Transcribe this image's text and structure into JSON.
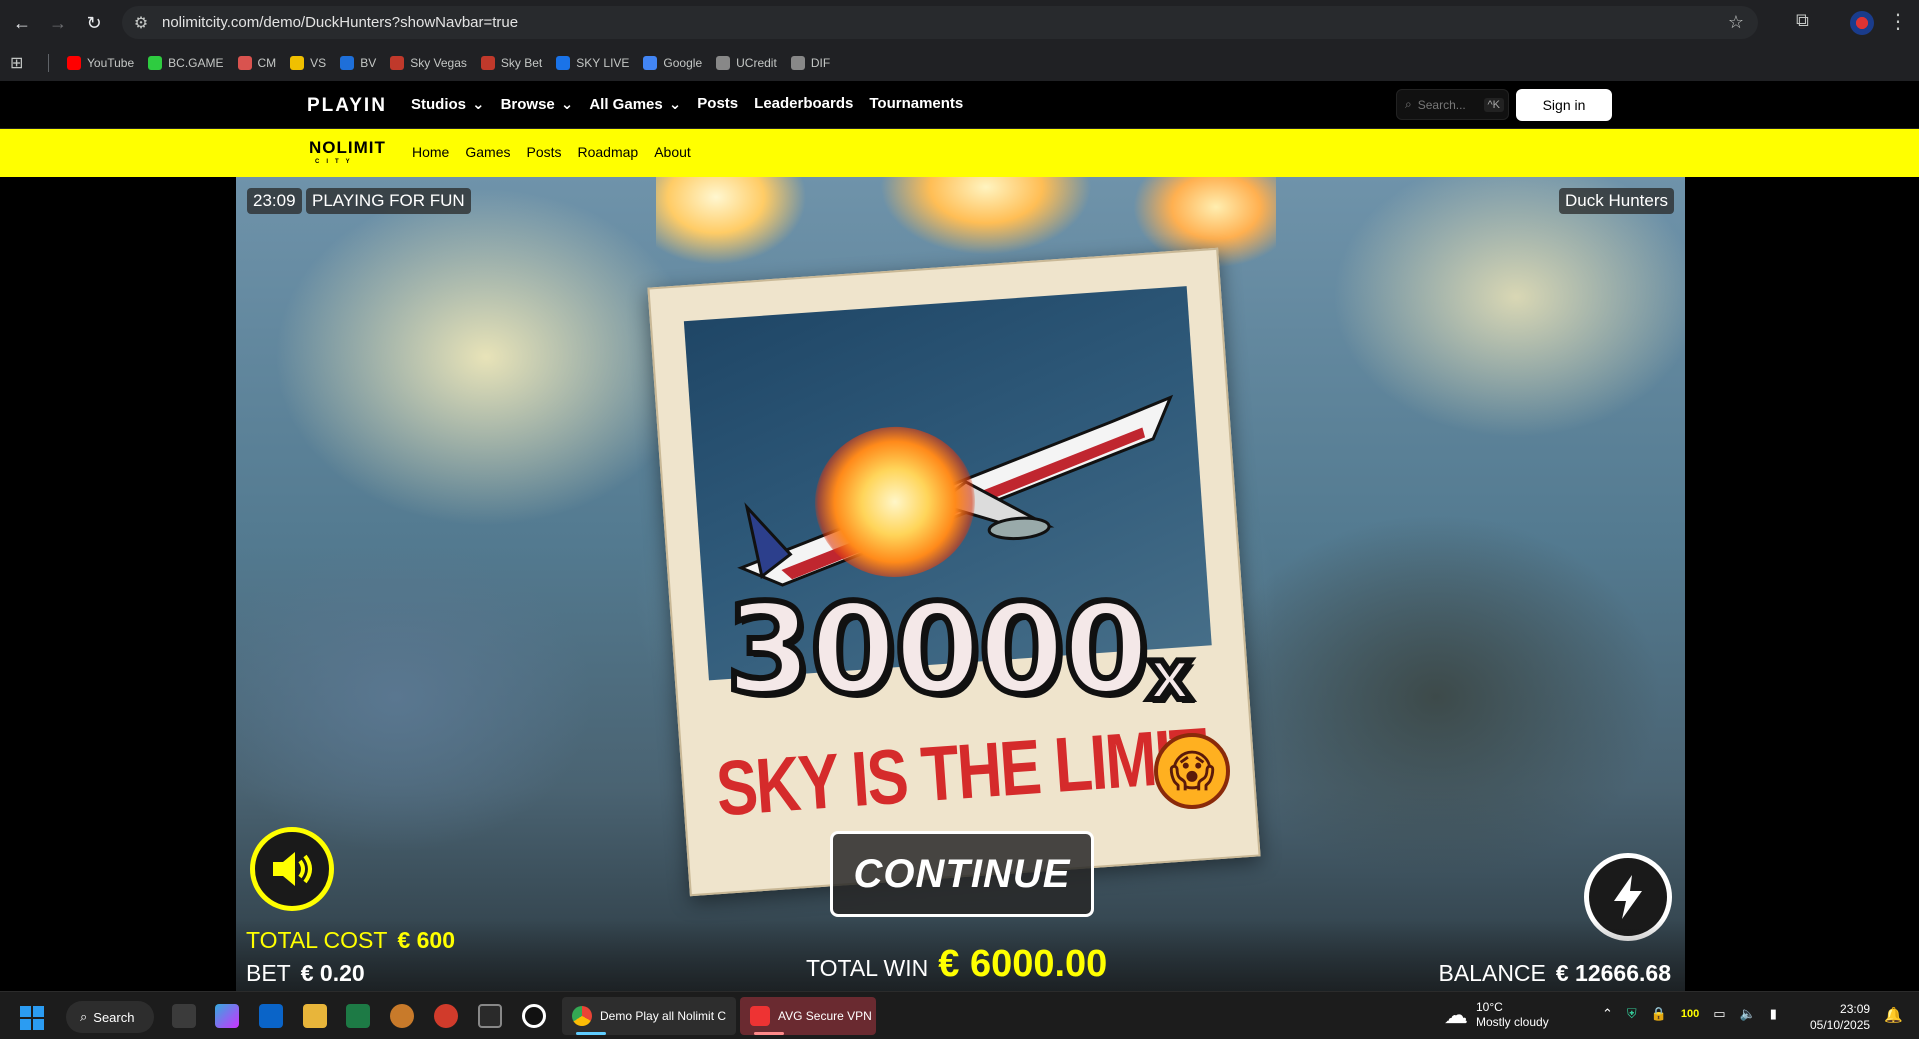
{
  "browser": {
    "url": "nolimitcity.com/demo/DuckHunters?showNavbar=true",
    "bookmarks": [
      {
        "label": "YouTube",
        "color": "#ff0000"
      },
      {
        "label": "BC.GAME",
        "color": "#2ecc40"
      },
      {
        "label": "CM",
        "color": "#d9534f"
      },
      {
        "label": "VS",
        "color": "#f0c000"
      },
      {
        "label": "BV",
        "color": "#1e6fd9"
      },
      {
        "label": "Sky Vegas",
        "color": "#c0392b"
      },
      {
        "label": "Sky Bet",
        "color": "#c0392b"
      },
      {
        "label": "SKY LIVE",
        "color": "#1a73e8"
      },
      {
        "label": "Google",
        "color": "#4285f4"
      },
      {
        "label": "UCredit",
        "color": "#888888"
      },
      {
        "label": "DIF",
        "color": "#888888"
      }
    ]
  },
  "playin": {
    "logo": "PLAYIN",
    "nav": [
      "Studios",
      "Browse",
      "All Games",
      "Posts",
      "Leaderboards",
      "Tournaments"
    ],
    "search_placeholder": "Search...",
    "search_shortcut": "^K",
    "signin_label": "Sign in"
  },
  "nolimit": {
    "logo": "NOLIMIT",
    "logo_sub": "CITY",
    "nav": [
      "Home",
      "Games",
      "Posts",
      "Roadmap",
      "About"
    ]
  },
  "game": {
    "time": "23:09",
    "mode": "PLAYING FOR FUN",
    "title": "Duck Hunters",
    "multiplier": "30000",
    "multiplier_suffix": "x",
    "banner": "SKY IS THE LIMIT",
    "continue_label": "CONTINUE",
    "total_cost_label": "TOTAL COST",
    "total_cost_value": "€ 600",
    "bet_label": "BET",
    "bet_value": "€ 0.20",
    "total_win_label": "TOTAL WIN",
    "total_win_value": "€ 6000.00",
    "balance_label": "BALANCE",
    "balance_value": "€ 12666.68"
  },
  "taskbar": {
    "search_label": "Search",
    "apps": [
      {
        "label": "Demo Play all Nolimit C"
      },
      {
        "label": "AVG Secure VPN"
      }
    ],
    "weather_temp": "10°C",
    "weather_desc": "Mostly cloudy",
    "battery_badge": "100",
    "time": "23:09",
    "date": "05/10/2025"
  },
  "colors": {
    "accent_yellow": "#ffff00",
    "win_red": "#d52b2b"
  }
}
